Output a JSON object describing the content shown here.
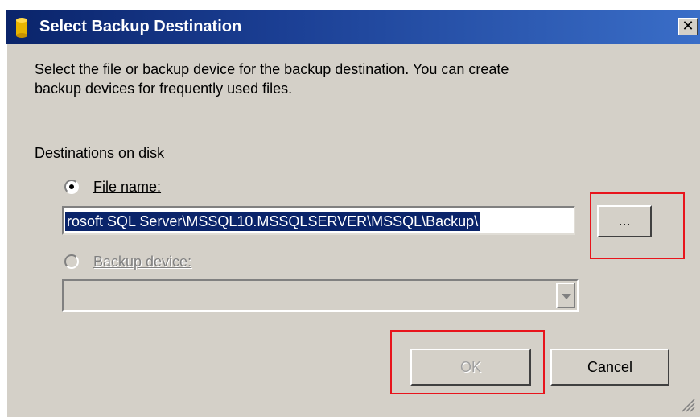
{
  "window": {
    "title": "Select Backup Destination",
    "close_glyph": "✕",
    "icon": "database-icon"
  },
  "description": {
    "line1": "Select the file or backup device for the backup destination. You can create",
    "line2": "backup devices for frequently used files."
  },
  "destinations": {
    "heading": "Destinations on disk",
    "file_name_label": "File name:",
    "file_name_checked": true,
    "file_name_value": "rosoft SQL Server\\MSSQL10.MSSQLSERVER\\MSSQL\\Backup\\",
    "browse_label": "...",
    "backup_device_label": "Backup device:",
    "backup_device_checked": false,
    "backup_device_value": ""
  },
  "buttons": {
    "ok_label": "OK",
    "cancel_label": "Cancel"
  },
  "colors": {
    "highlight_box": "#e8141c",
    "title_bar": "#0a246a",
    "dialog_face": "#d4d0c8"
  }
}
